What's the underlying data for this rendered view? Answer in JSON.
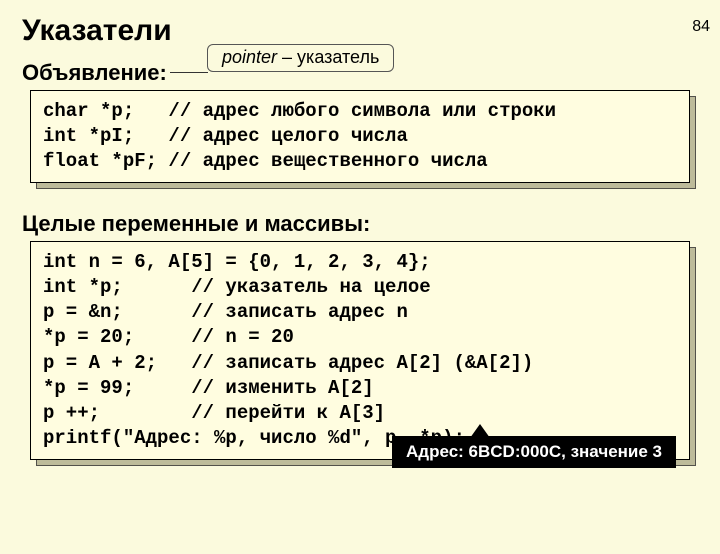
{
  "page_number": "84",
  "title": "Указатели",
  "section1": {
    "heading": "Объявление:",
    "callout_italic": "pointer",
    "callout_rest": " – указатель",
    "code": "char *p;   // адрес любого символа или строки\nint *pI;   // адрес целого числа\nfloat *pF; // адрес вещественного числа"
  },
  "section2": {
    "heading": "Целые переменные и массивы:",
    "code": "int n = 6, A[5] = {0, 1, 2, 3, 4};\nint *p;      // указатель на целое\np = &n;      // записать адрес n\n*p = 20;     // n = 20\np = A + 2;   // записать адрес A[2] (&A[2])\n*p = 99;     // изменить A[2]\np ++;        // перейти к A[3]\nprintf(\"Адрес: %p, число %d\", p, *p);"
  },
  "result_callout": "Адрес: 6BCD:000C, значение 3"
}
